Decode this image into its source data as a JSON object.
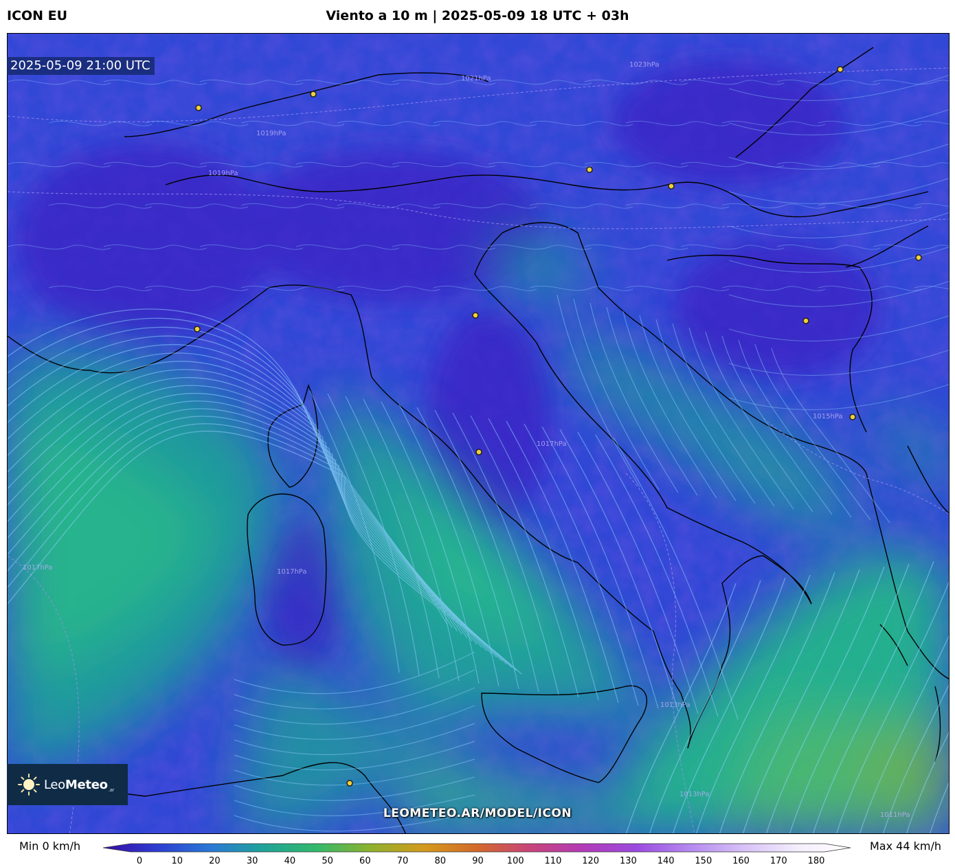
{
  "header": {
    "model": "ICON EU",
    "title": "Viento a 10 m | 2025-05-09 18 UTC + 03h"
  },
  "map": {
    "timestamp": "2025-05-09 21:00 UTC",
    "watermark": "LEOMETEO.AR/MODEL/ICON",
    "isobar_labels": [
      "1023hPa",
      "1021hPa",
      "1019hPa",
      "1019hPa",
      "1017hPa",
      "1017hPa",
      "1017hPa",
      "1015hPa",
      "1013hPa",
      "1013hPa",
      "1011hPa"
    ],
    "colors": {
      "calm": "#3a24c8",
      "light": "#2e5ad8",
      "moderate": "#1e9a9c",
      "fresh": "#2bc48a",
      "strong": "#5fb86a",
      "streamline": "#8fd0ff",
      "city_marker": "#f2d13a"
    }
  },
  "logo": {
    "brand_light": "Leo",
    "brand_bold": "Meteo",
    "suffix": ".ar"
  },
  "legend": {
    "min_label": "Min 0 km/h",
    "max_label": "Max 44 km/h",
    "unit": "km/h",
    "ticks": [
      "0",
      "10",
      "20",
      "30",
      "40",
      "50",
      "60",
      "70",
      "80",
      "90",
      "100",
      "110",
      "120",
      "130",
      "140",
      "150",
      "160",
      "170",
      "180"
    ],
    "range": [
      0,
      180
    ],
    "color_stops": [
      "#3a0ca3",
      "#2d3cd0",
      "#2a78d6",
      "#1fa39a",
      "#33b96a",
      "#8db22e",
      "#d49a1d",
      "#d36a2a",
      "#c8447a",
      "#b23ab8",
      "#9b4be0",
      "#b58af0",
      "#d7c1f7",
      "#f4eefc",
      "#ffffff"
    ]
  }
}
